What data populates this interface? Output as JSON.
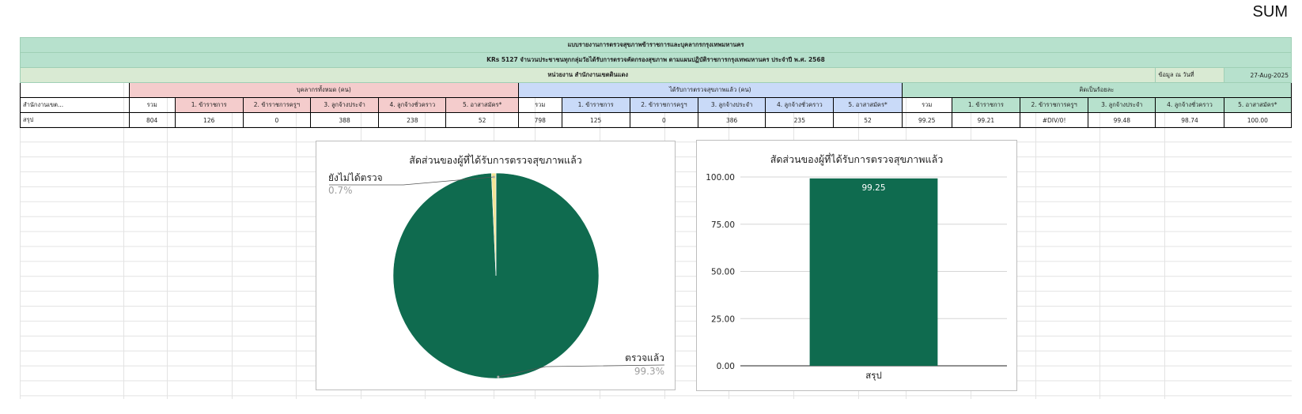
{
  "sum_label": "SUM",
  "report": {
    "title": "แบบรายงานการตรวจสุขภาพข้าราชการและบุคลากรกรุงเทพมหานคร",
    "subtitle": "KRs 5127 จำนวนประชาชนทุกกลุ่มวัยได้รับการตรวจคัดกรองสุขภาพ ตามแผนปฏิบัติราชการกรุงเทพมหานคร ประจำปี พ.ศ. 2568",
    "unit": "หน่วยงาน สำนักงานเขตดินแดง",
    "date_label": "ข้อมูล ณ วันที่",
    "date_value": "27-Aug-2025",
    "group_personnel": "บุคลากรทั้งหมด (คน)",
    "group_checked": "ได้รับการตรวจสุขภาพแล้ว (คน)",
    "group_percent": "คิดเป็นร้อยละ",
    "office_header": "สำนักงานเขต...",
    "col_headers": [
      "รวม",
      "1. ข้าราชการ",
      "2. ข้าราชการครูฯ",
      "3. ลูกจ้างประจำ",
      "4. ลูกจ้างชั่วคราว",
      "5. อาสาสมัคร*"
    ],
    "row_label": "สรุป",
    "personnel_values": [
      "804",
      "126",
      "0",
      "388",
      "238",
      "52"
    ],
    "checked_values": [
      "798",
      "125",
      "0",
      "386",
      "235",
      "52"
    ],
    "percent_values": [
      "99.25",
      "99.21",
      "#DIV/0!",
      "99.48",
      "98.74",
      "100.00"
    ]
  },
  "pie_chart": {
    "chart_data": {
      "type": "pie",
      "title": "สัดส่วนของผู้ที่ได้รับการตรวจสุขภาพแล้ว",
      "slices": [
        {
          "label": "ตรวจแล้ว",
          "value": 99.3,
          "display": "99.3%",
          "color": "#0f6b4f"
        },
        {
          "label": "ยังไม่ได้ตรวจ",
          "value": 0.7,
          "display": "0.7%",
          "color": "#f2e596"
        }
      ]
    }
  },
  "bar_chart": {
    "chart_data": {
      "type": "bar",
      "title": "สัดส่วนของผู้ที่ได้รับการตรวจสุขภาพแล้ว",
      "categories": [
        "สรุป"
      ],
      "values": [
        99.25
      ],
      "data_labels": [
        "99.25"
      ],
      "ylim": [
        0,
        100
      ],
      "yticks": [
        0,
        25,
        50,
        75,
        100
      ],
      "ytick_labels": [
        "0.00",
        "25.00",
        "50.00",
        "75.00",
        "100.00"
      ],
      "color": "#0f6b4f"
    }
  }
}
